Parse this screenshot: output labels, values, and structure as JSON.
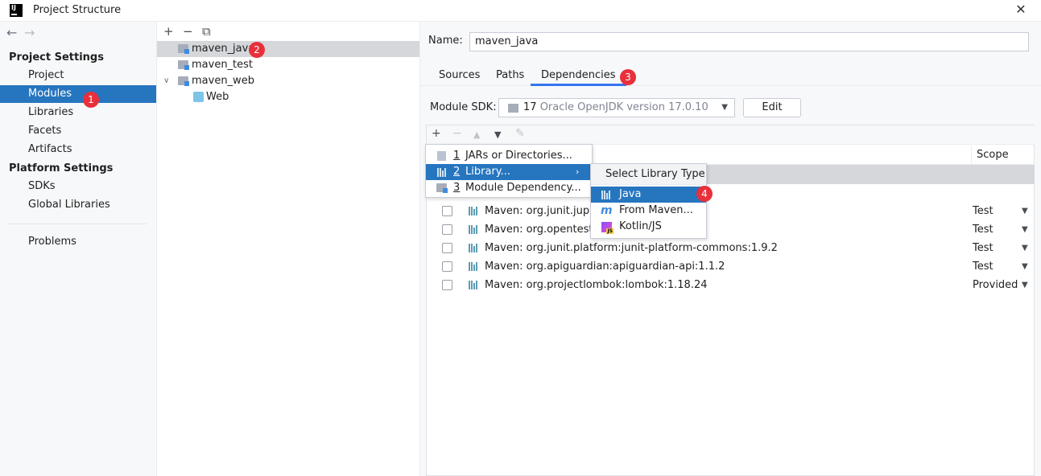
{
  "window": {
    "title": "Project Structure",
    "close_glyph": "✕",
    "app_icon_label": "IJ"
  },
  "nav": {
    "back": "←",
    "forward": "→"
  },
  "sidebar": {
    "project_settings": "Project Settings",
    "platform_settings": "Platform Settings",
    "items": [
      {
        "label": "Project"
      },
      {
        "label": "Modules"
      },
      {
        "label": "Libraries"
      },
      {
        "label": "Facets"
      },
      {
        "label": "Artifacts"
      },
      {
        "label": "SDKs"
      },
      {
        "label": "Global Libraries"
      },
      {
        "label": "Problems"
      }
    ]
  },
  "tree": {
    "tools": {
      "add": "+",
      "remove": "−",
      "copy": "⧉"
    },
    "items": [
      {
        "label": "maven_java"
      },
      {
        "label": "maven_test"
      },
      {
        "label": "maven_web"
      },
      {
        "label": "Web"
      }
    ],
    "chevron": "∨"
  },
  "badges": [
    "1",
    "2",
    "3",
    "4"
  ],
  "module": {
    "name_label": "Name:",
    "name_value": "maven_java",
    "tabs": [
      "Sources",
      "Paths",
      "Dependencies"
    ],
    "sdk_label": "Module SDK:",
    "sdk_version": "17",
    "sdk_detail": "Oracle OpenJDK version 17.0.10",
    "edit_label": "Edit",
    "dropdown_glyph": "▼"
  },
  "dependencies": {
    "tools": {
      "add": "+",
      "remove": "−",
      "up": "▲",
      "down": "▼",
      "edit": "✎"
    },
    "scope_header": "Scope",
    "rows": [
      {
        "text": "Maven: org.junit.jupiter",
        "scope": "Test"
      },
      {
        "text": "Maven: org.opentest4j",
        "scope": "Test"
      },
      {
        "text": "Maven: org.junit.platform:junit-platform-commons:1.9.2",
        "scope": "Test"
      },
      {
        "text": "Maven: org.apiguardian:apiguardian-api:1.1.2",
        "scope": "Test"
      },
      {
        "text": "Maven: org.projectlombok:lombok:1.18.24",
        "scope": "Provided"
      }
    ]
  },
  "add_menu": {
    "items": [
      {
        "num": "1",
        "text": "JARs or Directories..."
      },
      {
        "num": "2",
        "text": "Library..."
      },
      {
        "num": "3",
        "text": "Module Dependency..."
      }
    ],
    "submenu_arrow": "›"
  },
  "library_type_menu": {
    "title": "Select Library Type",
    "items": [
      {
        "text": "Java"
      },
      {
        "text": "From Maven..."
      },
      {
        "text": "Kotlin/JS"
      }
    ],
    "maven_glyph": "m"
  },
  "colors": {
    "selection": "#2675bf",
    "badge": "#e8303a",
    "tab_underline": "#3574f0"
  }
}
